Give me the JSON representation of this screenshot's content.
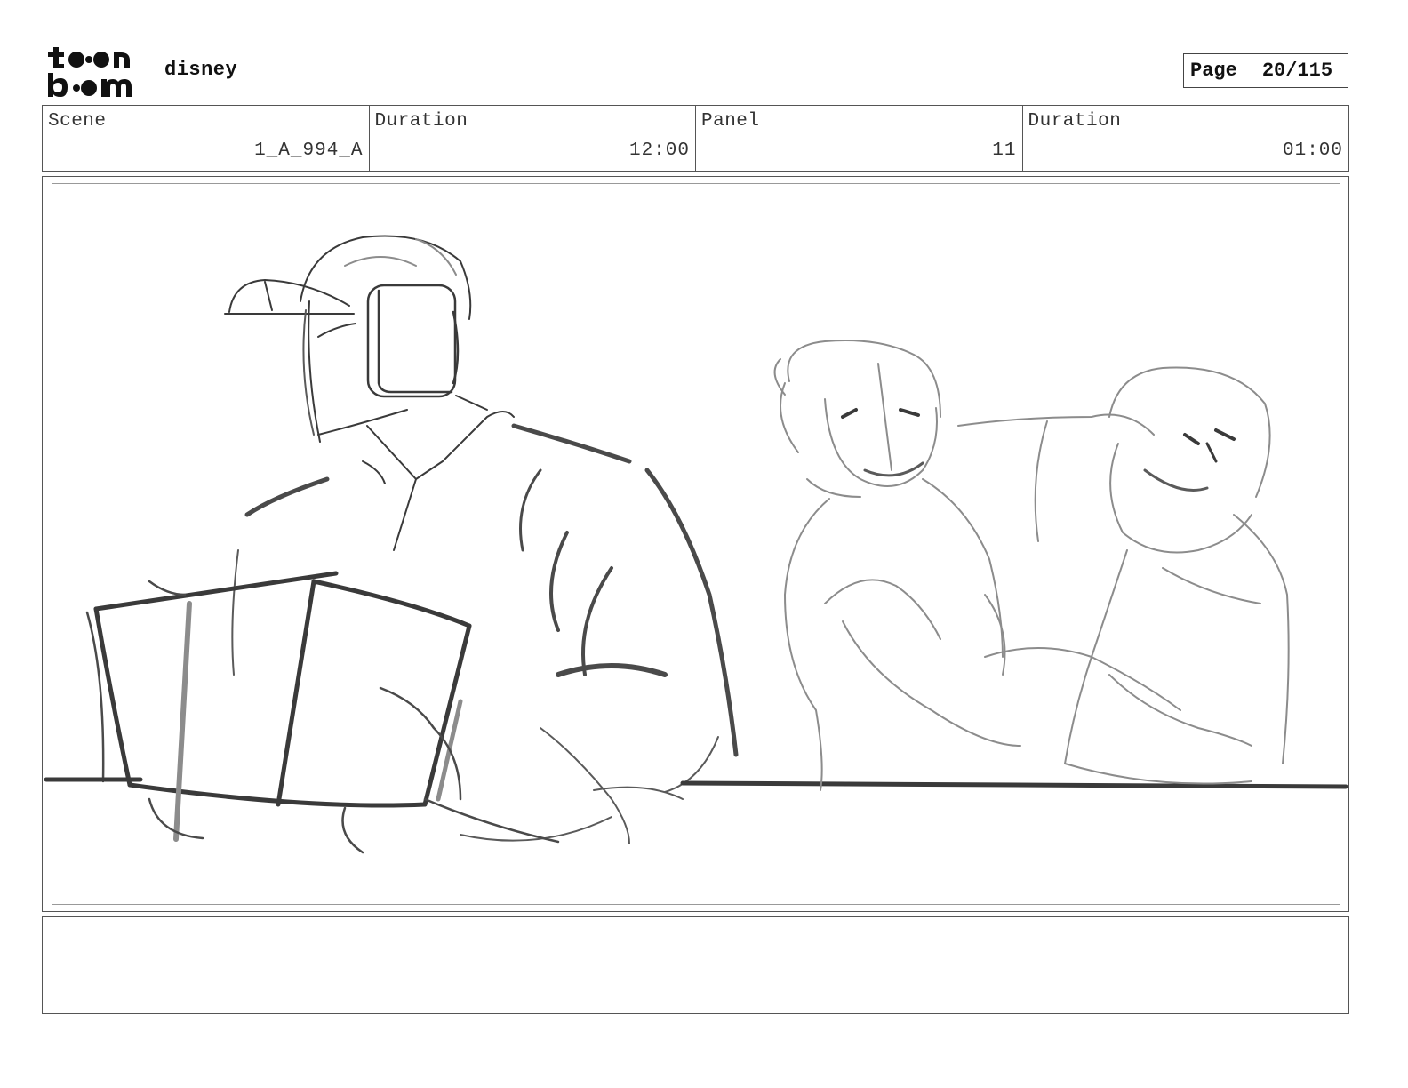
{
  "header": {
    "logo_text_top": "toon",
    "logo_text_bottom": "boom",
    "project": "disney",
    "page_label": "Page",
    "page_value": "20/115"
  },
  "info": [
    {
      "head": "Scene",
      "value": "1_A_994_A"
    },
    {
      "head": "Duration",
      "value": "12:00"
    },
    {
      "head": "Panel",
      "value": "11"
    },
    {
      "head": "Duration",
      "value": "01:00"
    }
  ],
  "colors": {
    "sketch_dark": "#3a3a3a",
    "sketch_mid": "#5a5a5a",
    "sketch_light": "#8c8c8c",
    "border": "#555555"
  },
  "icons": {
    "logo": "toonboom-logo-icon"
  }
}
